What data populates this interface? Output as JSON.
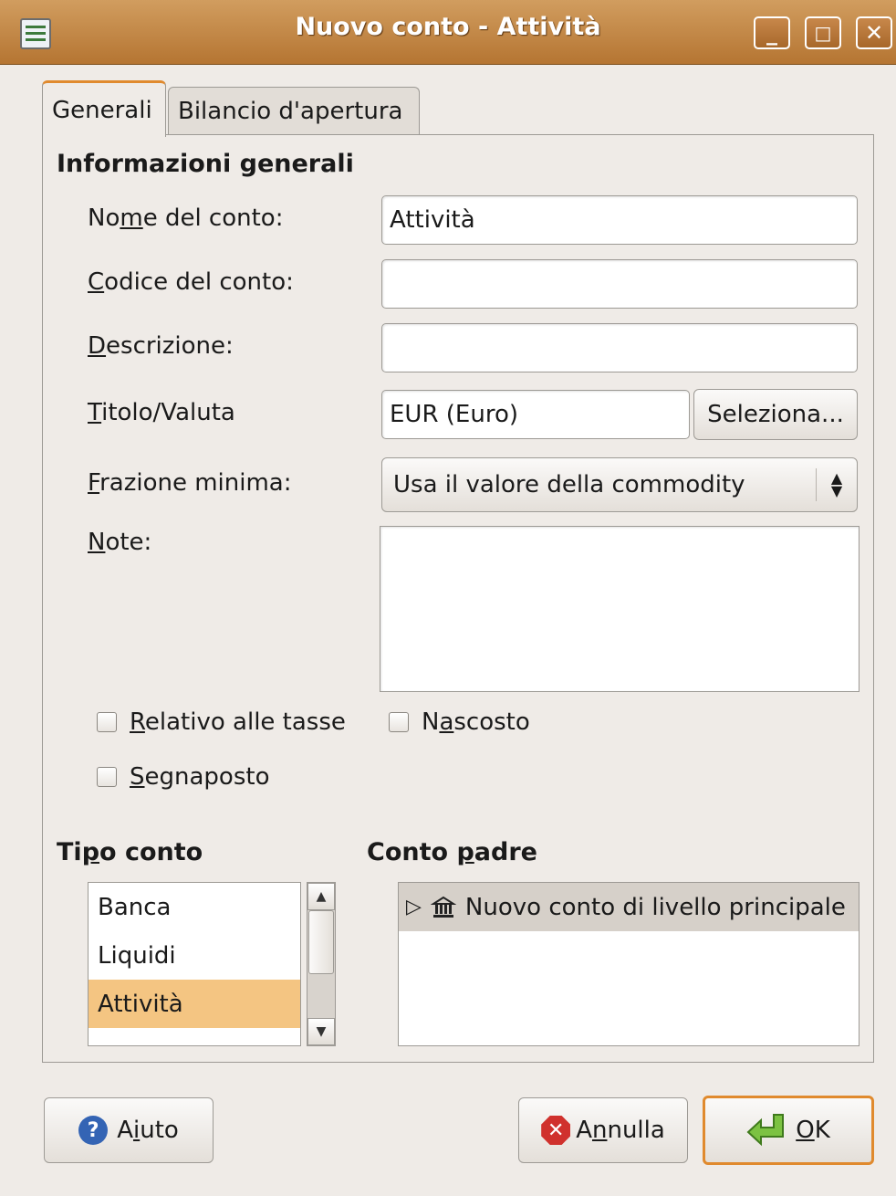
{
  "window": {
    "title": "Nuovo conto - Attività",
    "minimize": "_",
    "maximize": "□",
    "close": "✕"
  },
  "tabs": [
    {
      "label": "Generali"
    },
    {
      "label": "Bilancio d'apertura"
    }
  ],
  "general": {
    "section_title": "Informazioni generali",
    "name": {
      "label_pre": "No",
      "label_u": "m",
      "label_post": "e del conto:",
      "value": "Attività"
    },
    "code": {
      "label_u": "C",
      "label_post": "odice del conto:",
      "value": ""
    },
    "description": {
      "label_u": "D",
      "label_post": "escrizione:",
      "value": ""
    },
    "commodity": {
      "label_u": "T",
      "label_post": "itolo/Valuta",
      "value": "EUR (Euro)",
      "select_button": "Seleziona..."
    },
    "fraction": {
      "label_u": "F",
      "label_post": "razione minima:",
      "value": "Usa il valore della commodity"
    },
    "notes": {
      "label_u": "N",
      "label_post": "ote:",
      "value": ""
    },
    "tax_related": {
      "label_u": "R",
      "label_post": "elativo alle tasse",
      "checked": false
    },
    "hidden": {
      "label_pre": "N",
      "label_u": "a",
      "label_post": "scosto",
      "checked": false
    },
    "placeholder": {
      "label_u": "S",
      "label_post": "egnaposto",
      "checked": false
    }
  },
  "account_type": {
    "title_pre": "Ti",
    "title_u": "p",
    "title_post": "o conto",
    "items": [
      "Banca",
      "Liquidi",
      "Attività"
    ],
    "selected": "Attività"
  },
  "parent_account": {
    "title_pre": "Conto ",
    "title_u": "p",
    "title_post": "adre",
    "root_label": "Nuovo conto di livello principale",
    "expander": "▷"
  },
  "buttons": {
    "help": {
      "pre": "A",
      "u": "i",
      "post": "uto"
    },
    "cancel": {
      "pre": "A",
      "u": "n",
      "post": "nulla"
    },
    "ok": {
      "u": "O",
      "post": "K"
    }
  },
  "colors": {
    "titlebar": "#b57532",
    "selection": "#f4c582",
    "focus": "#e08a2e"
  }
}
